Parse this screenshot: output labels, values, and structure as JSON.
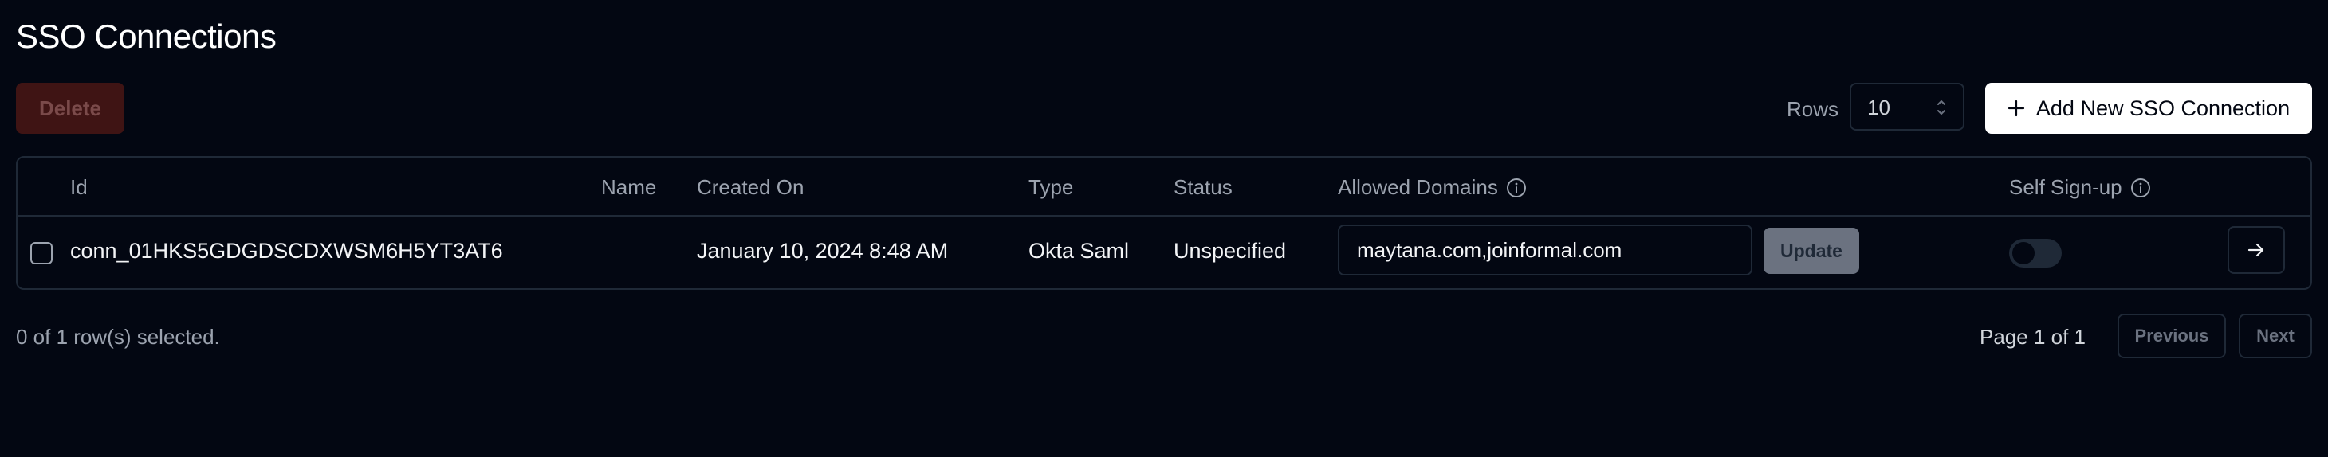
{
  "page": {
    "title": "SSO Connections"
  },
  "toolbar": {
    "delete_label": "Delete",
    "rows_label": "Rows",
    "rows_value": "10",
    "add_label": "Add New SSO Connection"
  },
  "table": {
    "headers": {
      "id": "Id",
      "name": "Name",
      "created_on": "Created On",
      "type": "Type",
      "status": "Status",
      "allowed_domains": "Allowed Domains",
      "self_signup": "Self Sign-up"
    },
    "rows": [
      {
        "id": "conn_01HKS5GDGDSCDXWSM6H5YT3AT6",
        "name": "",
        "created_on": "January 10, 2024 8:48 AM",
        "type": "Okta Saml",
        "status": "Unspecified",
        "allowed_domains": "maytana.com,joinformal.com",
        "update_label": "Update",
        "self_signup_enabled": false
      }
    ]
  },
  "footer": {
    "selection_text": "0 of 1 row(s) selected.",
    "page_info": "Page 1 of 1",
    "previous_label": "Previous",
    "next_label": "Next"
  },
  "colors": {
    "background": "#030712",
    "border": "#1f2937",
    "delete_bg": "#3f1414",
    "primary_button_bg": "#ffffff",
    "muted_text": "#9ca3af"
  }
}
